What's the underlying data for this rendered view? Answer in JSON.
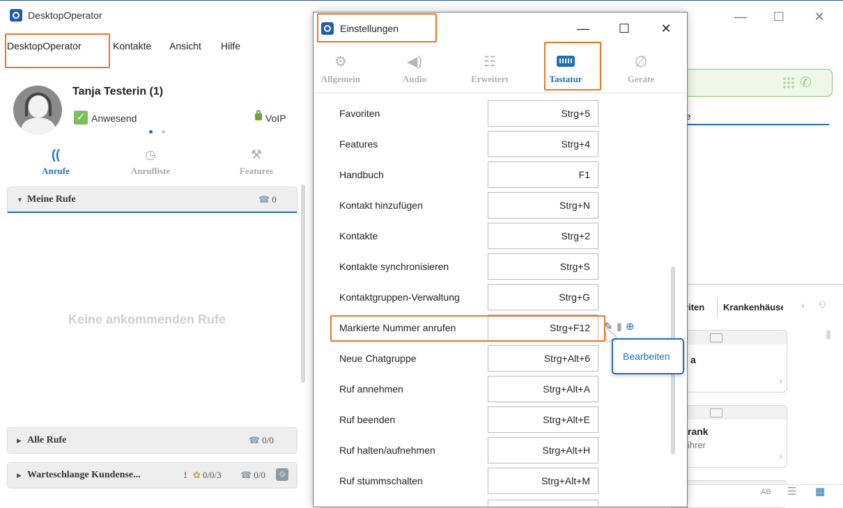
{
  "main_window": {
    "title": "DesktopOperator",
    "controls": {
      "minimize": "—",
      "maximize": "☐",
      "close": "✕"
    }
  },
  "menu": [
    "DesktopOperator",
    "Kontakte",
    "Ansicht",
    "Hilfe"
  ],
  "user": {
    "name": "Tanja Testerin (1)",
    "status": "Anwesend",
    "connection": "VoIP"
  },
  "nav_tabs": [
    {
      "label": "Anrufe",
      "icon": "calls-icon",
      "active": true
    },
    {
      "label": "Anrufliste",
      "icon": "clock-icon",
      "active": false
    },
    {
      "label": "Features",
      "icon": "wrench-icon",
      "active": false
    }
  ],
  "sections": {
    "my_calls": {
      "title": "Meine Rufe",
      "count": "0",
      "empty_text": "Keine ankommenden Rufe"
    },
    "all_calls": {
      "title": "Alle Rufe",
      "count": "0/0"
    },
    "queue": {
      "title": "Warteschlange Kundense...",
      "alert": "!",
      "agents": "0/0/3",
      "count": "0/0"
    }
  },
  "behind": {
    "tab_partial": "ıfe",
    "tabs_partial": [
      "riten",
      "Krankenhäuse"
    ],
    "card1_text": "a",
    "card2_title": "rank",
    "card2_sub": "ihrer",
    "bottom_text": "AB"
  },
  "dialog": {
    "title": "Einstellungen",
    "controls": {
      "minimize": "—",
      "maximize": "☐",
      "close": "✕"
    },
    "tabs": [
      {
        "label": "Allgemein",
        "icon": "gears-icon"
      },
      {
        "label": "Audio",
        "icon": "speaker-icon"
      },
      {
        "label": "Erweitert",
        "icon": "advanced-list-icon"
      },
      {
        "label": "Tastatur",
        "icon": "keyboard-icon",
        "active": true
      },
      {
        "label": "Geräte",
        "icon": "devices-icon"
      }
    ],
    "shortcuts": [
      {
        "name": "Favoriten",
        "key": "Strg+5"
      },
      {
        "name": "Features",
        "key": "Strg+4"
      },
      {
        "name": "Handbuch",
        "key": "F1"
      },
      {
        "name": "Kontakt hinzufügen",
        "key": "Strg+N"
      },
      {
        "name": "Kontakte",
        "key": "Strg+2"
      },
      {
        "name": "Kontakte synchronisieren",
        "key": "Strg+S"
      },
      {
        "name": "Kontaktgruppen-Verwaltung",
        "key": "Strg+G"
      },
      {
        "name": "Markierte Nummer anrufen",
        "key": "Strg+F12"
      },
      {
        "name": "Neue Chatgruppe",
        "key": "Strg+Alt+6"
      },
      {
        "name": "Ruf annehmen",
        "key": "Strg+Alt+A"
      },
      {
        "name": "Ruf beenden",
        "key": "Strg+Alt+E"
      },
      {
        "name": "Ruf halten/aufnehmen",
        "key": "Strg+Alt+H"
      },
      {
        "name": "Ruf stummschalten",
        "key": "Strg+Alt+M"
      }
    ],
    "tooltip": "Bearbeiten"
  },
  "colors": {
    "accent": "#1f6fb5",
    "highlight": "#e87722",
    "status_green": "#7dc15a"
  }
}
